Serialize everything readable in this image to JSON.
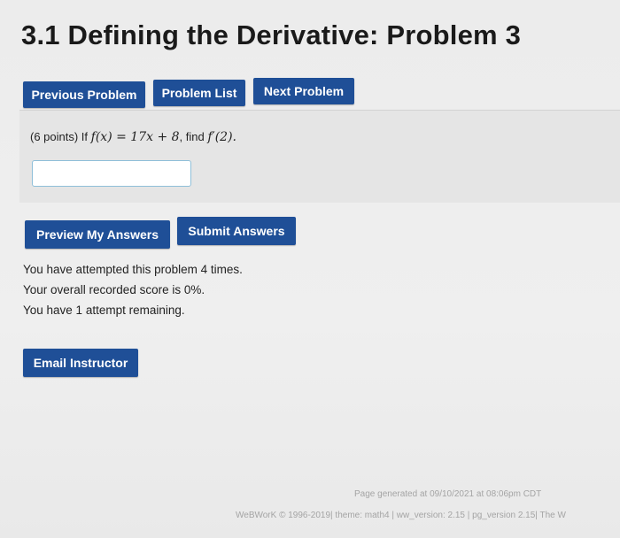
{
  "header": {
    "title": "3.1 Defining the Derivative: Problem 3"
  },
  "nav": {
    "previous_label": "Previous Problem",
    "list_label": "Problem List",
    "next_label": "Next Problem"
  },
  "problem": {
    "points": "(6 points) If",
    "function_expr": "f(x) = 17x + 8",
    "find_label": ", find",
    "derivative_expr": "f′(2).",
    "answer_value": "",
    "answer_placeholder": ""
  },
  "actions": {
    "preview_label": "Preview My Answers",
    "submit_label": "Submit Answers"
  },
  "status": {
    "attempts": "You have attempted this problem 4 times.",
    "score": "Your overall recorded score is 0%.",
    "remaining": "You have 1 attempt remaining."
  },
  "email": {
    "label": "Email Instructor"
  },
  "footer": {
    "generated": "Page generated at 09/10/2021 at 08:06pm CDT",
    "credits": "WeBWorK © 1996-2019| theme: math4 | ww_version: 2.15 | pg_version 2.15| The W"
  },
  "colors": {
    "button_bg": "#1f4f97",
    "input_border": "#8fbfd9"
  }
}
